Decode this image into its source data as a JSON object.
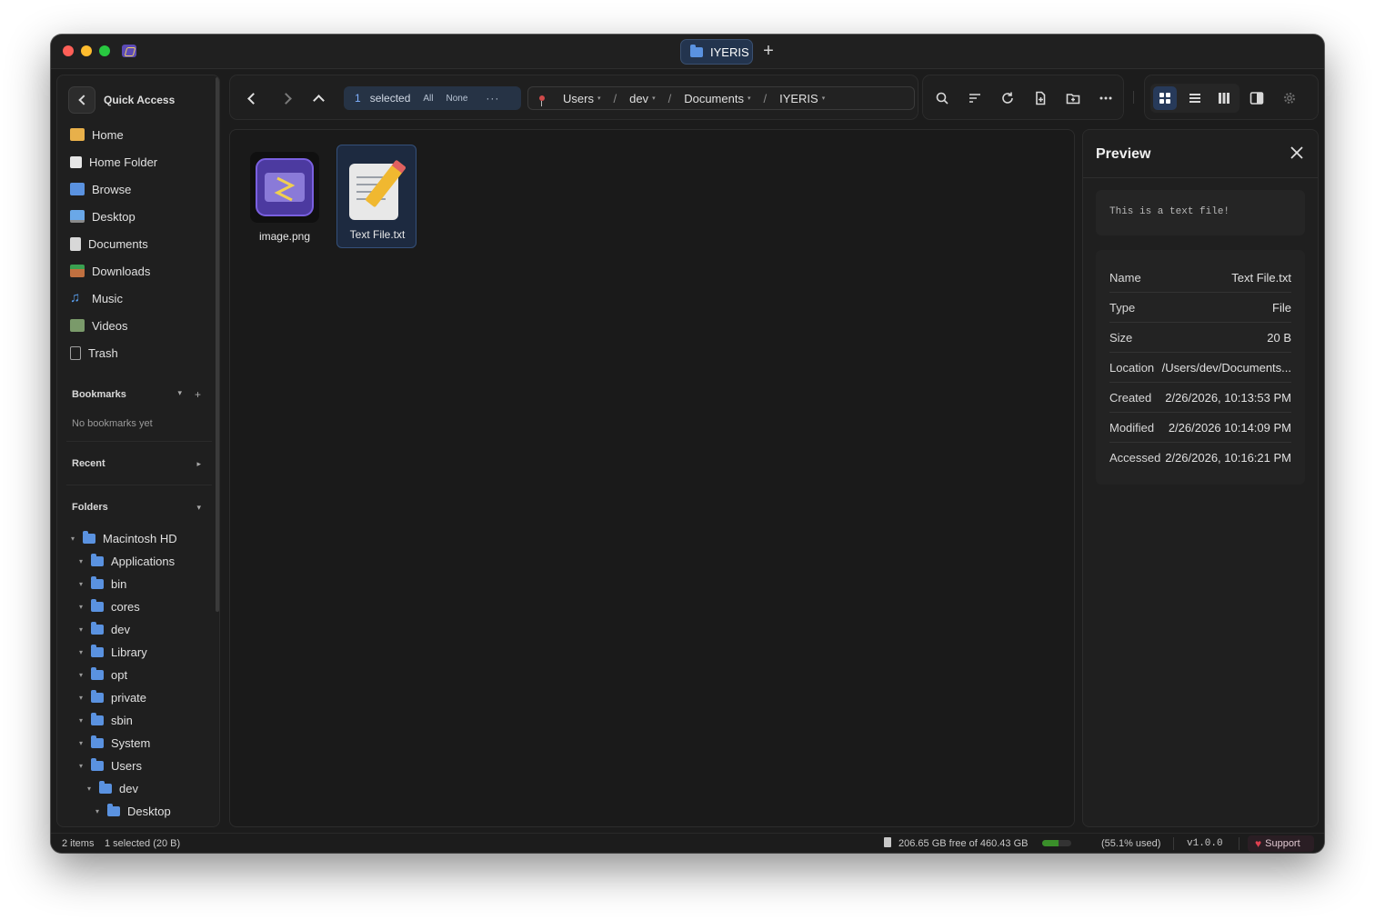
{
  "window": {
    "tab_label": "IYERIS",
    "add_tab": "+"
  },
  "sidebar": {
    "quick_access_title": "Quick Access",
    "quick_access": [
      {
        "label": "Home",
        "icon": "home-icon"
      },
      {
        "label": "Home Folder",
        "icon": "home-folder-icon"
      },
      {
        "label": "Browse",
        "icon": "browse-folder-icon"
      },
      {
        "label": "Desktop",
        "icon": "desktop-icon"
      },
      {
        "label": "Documents",
        "icon": "documents-icon"
      },
      {
        "label": "Downloads",
        "icon": "downloads-icon"
      },
      {
        "label": "Music",
        "icon": "music-icon"
      },
      {
        "label": "Videos",
        "icon": "videos-icon"
      },
      {
        "label": "Trash",
        "icon": "trash-icon"
      }
    ],
    "bookmarks_title": "Bookmarks",
    "bookmarks_empty": "No bookmarks yet",
    "recent_title": "Recent",
    "folders_title": "Folders",
    "tree": [
      {
        "label": "Macintosh HD",
        "depth": 0
      },
      {
        "label": "Applications",
        "depth": 1
      },
      {
        "label": "bin",
        "depth": 1
      },
      {
        "label": "cores",
        "depth": 1
      },
      {
        "label": "dev",
        "depth": 1
      },
      {
        "label": "Library",
        "depth": 1
      },
      {
        "label": "opt",
        "depth": 1
      },
      {
        "label": "private",
        "depth": 1
      },
      {
        "label": "sbin",
        "depth": 1
      },
      {
        "label": "System",
        "depth": 1
      },
      {
        "label": "Users",
        "depth": 1
      },
      {
        "label": "dev",
        "depth": 2
      },
      {
        "label": "Desktop",
        "depth": 3
      }
    ]
  },
  "toolbar": {
    "selected_count": "1",
    "selected_label": "selected",
    "select_all": "All",
    "select_none": "None",
    "more": "···",
    "breadcrumb": [
      "Users",
      "dev",
      "Documents",
      "IYERIS"
    ]
  },
  "files": [
    {
      "name": "image.png",
      "selected": false
    },
    {
      "name": "Text File.txt",
      "selected": true
    }
  ],
  "preview": {
    "title": "Preview",
    "content": "This is a text file!",
    "properties": [
      {
        "key": "Name",
        "value": "Text File.txt"
      },
      {
        "key": "Type",
        "value": "File"
      },
      {
        "key": "Size",
        "value": "20 B"
      },
      {
        "key": "Location",
        "value": "/Users/dev/Documents..."
      },
      {
        "key": "Created",
        "value": "2/26/2026, 10:13:53 PM"
      },
      {
        "key": "Modified",
        "value": "2/26/2026 10:14:09 PM"
      },
      {
        "key": "Accessed",
        "value": "2/26/2026, 10:16:21 PM"
      }
    ]
  },
  "status": {
    "items": "2 items",
    "selection": "1 selected (20 B)",
    "disk": "206.65 GB free of 460.43 GB",
    "disk_used_fraction": 0.551,
    "used": "(55.1% used)",
    "version": "v1.0.0",
    "support": "Support"
  },
  "colors": {
    "accent": "#5a92e0",
    "selection_bg": "#1d2a40",
    "disk_bar": "#3a8f2a",
    "heart": "#e04050"
  }
}
